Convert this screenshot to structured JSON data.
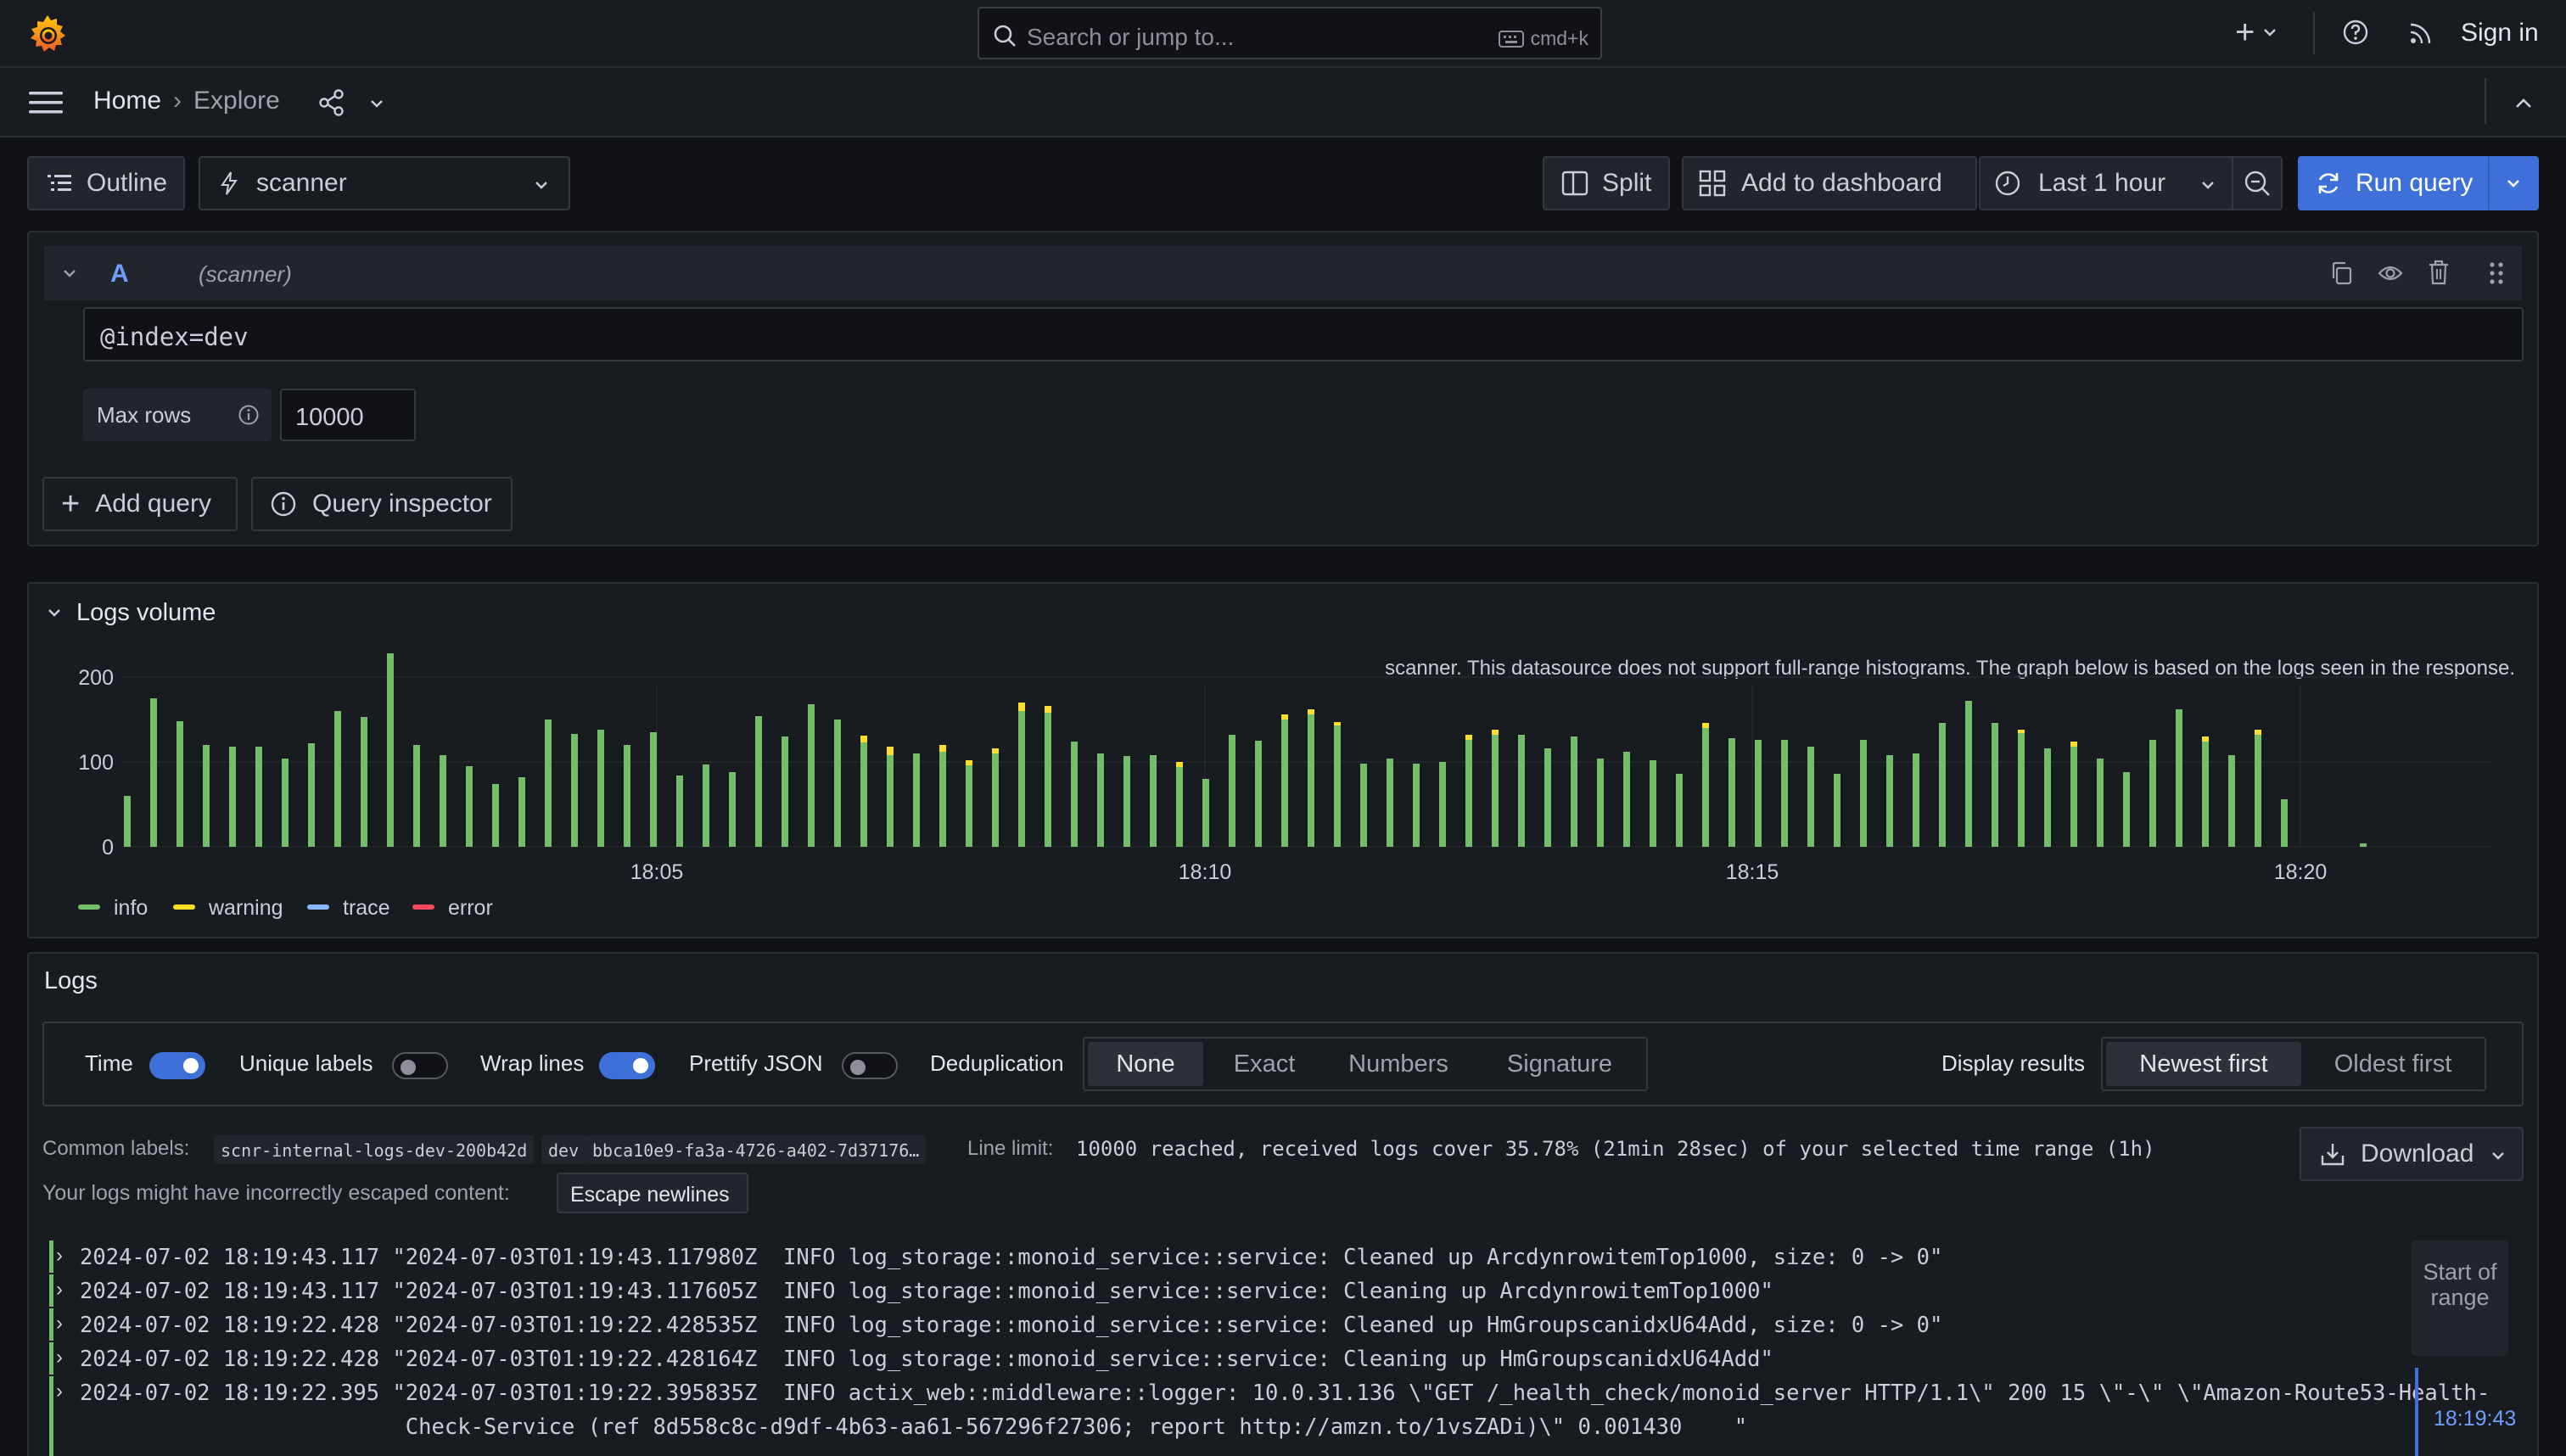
{
  "topbar": {
    "search_placeholder": "Search or jump to...",
    "search_shortcut": "cmd+k",
    "new_label": "+",
    "sign_in": "Sign in"
  },
  "breadcrumb": {
    "home": "Home",
    "separator": "›",
    "explore": "Explore"
  },
  "toolbar": {
    "outline": "Outline",
    "datasource": "scanner",
    "split": "Split",
    "add_to_dashboard": "Add to dashboard",
    "time_range": "Last 1 hour",
    "run_query": "Run query"
  },
  "query": {
    "ref_id": "A",
    "datasource_hint": "(scanner)",
    "expression": "@index=dev",
    "max_rows_label": "Max rows",
    "max_rows_value": "10000",
    "add_query": "Add query",
    "query_inspector": "Query inspector"
  },
  "logs_volume": {
    "title": "Logs volume",
    "notice": "scanner. This datasource does not support full-range histograms. The graph below is based on the logs seen in the response."
  },
  "chart_data": {
    "type": "bar",
    "stacked": true,
    "ylim": [
      0,
      230
    ],
    "y_ticks": [
      "200",
      "100",
      "0"
    ],
    "x_ticks": [
      "18:05",
      "18:10",
      "18:15",
      "18:20"
    ],
    "legend": [
      "info",
      "warning",
      "trace",
      "error"
    ],
    "legend_colors": [
      "#73bf69",
      "#fade2a",
      "#8ab8ff",
      "#f2495c"
    ],
    "grid": true,
    "series": [
      {
        "name": "info",
        "values": [
          60,
          175,
          148,
          120,
          118,
          118,
          104,
          122,
          160,
          153,
          228,
          120,
          108,
          95,
          74,
          82,
          150,
          133,
          138,
          120,
          135,
          84,
          97,
          88,
          154,
          130,
          168,
          150,
          123,
          108,
          110,
          112,
          96,
          110,
          160,
          158,
          124,
          110,
          107,
          108,
          94,
          80,
          132,
          125,
          150,
          156,
          143,
          98,
          104,
          98,
          100,
          126,
          132,
          132,
          116,
          130,
          104,
          112,
          102,
          86,
          140,
          128,
          126,
          126,
          118,
          86,
          126,
          108,
          110,
          146,
          172,
          146,
          134,
          116,
          118,
          104,
          88,
          126,
          162,
          124,
          108,
          132,
          56,
          0,
          0,
          4
        ]
      },
      {
        "name": "warning",
        "values": [
          0,
          0,
          0,
          0,
          0,
          0,
          0,
          0,
          0,
          0,
          0,
          0,
          0,
          0,
          0,
          0,
          0,
          0,
          0,
          0,
          0,
          0,
          0,
          0,
          0,
          0,
          0,
          0,
          8,
          10,
          0,
          8,
          6,
          6,
          10,
          8,
          0,
          0,
          0,
          0,
          6,
          0,
          0,
          0,
          6,
          6,
          4,
          0,
          0,
          0,
          0,
          6,
          6,
          0,
          0,
          0,
          0,
          0,
          0,
          0,
          6,
          0,
          0,
          0,
          0,
          0,
          0,
          0,
          0,
          0,
          0,
          0,
          4,
          0,
          6,
          0,
          0,
          0,
          0,
          6,
          0,
          6,
          0,
          0,
          0,
          0
        ]
      },
      {
        "name": "trace",
        "values": [
          0,
          0,
          0,
          0,
          0,
          0,
          0,
          0,
          0,
          0,
          0,
          0,
          0,
          0,
          0,
          0,
          0,
          0,
          0,
          0,
          0,
          0,
          0,
          0,
          0,
          0,
          0,
          0,
          0,
          0,
          0,
          0,
          0,
          0,
          0,
          0,
          0,
          0,
          0,
          0,
          0,
          0,
          0,
          0,
          0,
          0,
          0,
          0,
          0,
          0,
          0,
          0,
          0,
          0,
          0,
          0,
          0,
          0,
          0,
          0,
          0,
          0,
          0,
          0,
          0,
          0,
          0,
          0,
          0,
          0,
          0,
          0,
          0,
          0,
          0,
          0,
          0,
          0,
          0,
          0,
          0,
          0,
          0,
          0,
          0,
          0
        ]
      },
      {
        "name": "error",
        "values": [
          0,
          0,
          0,
          0,
          0,
          0,
          0,
          0,
          0,
          0,
          0,
          0,
          0,
          0,
          0,
          0,
          0,
          0,
          0,
          0,
          0,
          0,
          0,
          0,
          0,
          0,
          0,
          0,
          0,
          0,
          0,
          0,
          0,
          0,
          0,
          0,
          0,
          0,
          0,
          0,
          0,
          0,
          0,
          0,
          0,
          0,
          0,
          0,
          0,
          0,
          0,
          0,
          0,
          0,
          0,
          0,
          0,
          0,
          0,
          0,
          0,
          0,
          0,
          0,
          0,
          0,
          0,
          0,
          0,
          0,
          0,
          0,
          0,
          0,
          0,
          0,
          0,
          0,
          0,
          0,
          0,
          0,
          0,
          0,
          0,
          0
        ]
      }
    ]
  },
  "logs": {
    "title": "Logs",
    "options": {
      "time": "Time",
      "time_on": true,
      "unique_labels": "Unique labels",
      "unique_labels_on": false,
      "wrap_lines": "Wrap lines",
      "wrap_lines_on": true,
      "prettify_json": "Prettify JSON",
      "prettify_json_on": false,
      "deduplication": "Deduplication",
      "dedup_options": [
        "None",
        "Exact",
        "Numbers",
        "Signature"
      ],
      "dedup_selected": "None",
      "display_results": "Display results",
      "order_options": [
        "Newest first",
        "Oldest first"
      ],
      "order_selected": "Newest first"
    },
    "common_labels_label": "Common labels:",
    "common_labels": [
      "scnr-internal-logs-dev-200b42d",
      "dev",
      "bbca10e9-fa3a-4726-a402-7d37176…"
    ],
    "line_limit_label": "Line limit:",
    "line_limit_text": "10000 reached, received logs cover 35.78% (21min 28sec) of your selected time range (1h)",
    "download": "Download",
    "escape_warning": "Your logs might have incorrectly escaped content:",
    "escape_button": "Escape newlines",
    "lines": [
      "2024-07-02 18:19:43.117 \"2024-07-03T01:19:43.117980Z  INFO log_storage::monoid_service::service: Cleaned up ArcdynrowitemTop1000, size: 0 -> 0\"",
      "2024-07-02 18:19:43.117 \"2024-07-03T01:19:43.117605Z  INFO log_storage::monoid_service::service: Cleaning up ArcdynrowitemTop1000\"",
      "2024-07-02 18:19:22.428 \"2024-07-03T01:19:22.428535Z  INFO log_storage::monoid_service::service: Cleaned up HmGroupscanidxU64Add, size: 0 -> 0\"",
      "2024-07-02 18:19:22.428 \"2024-07-03T01:19:22.428164Z  INFO log_storage::monoid_service::service: Cleaning up HmGroupscanidxU64Add\"",
      "2024-07-02 18:19:22.395 \"2024-07-03T01:19:22.395835Z  INFO actix_web::middleware::logger: 10.0.31.136 \\\"GET /_health_check/monoid_server HTTP/1.1\\\" 200 15 \\\"-\\\" \\\"Amazon-Route53-Health-",
      "                         Check-Service (ref 8d558c8c-d9df-4b63-aa61-567296f27306; report http://amzn.to/1vsZADi)\\\" 0.001430    \""
    ],
    "range_start": "Start of range",
    "range_time": "18:19:43"
  }
}
